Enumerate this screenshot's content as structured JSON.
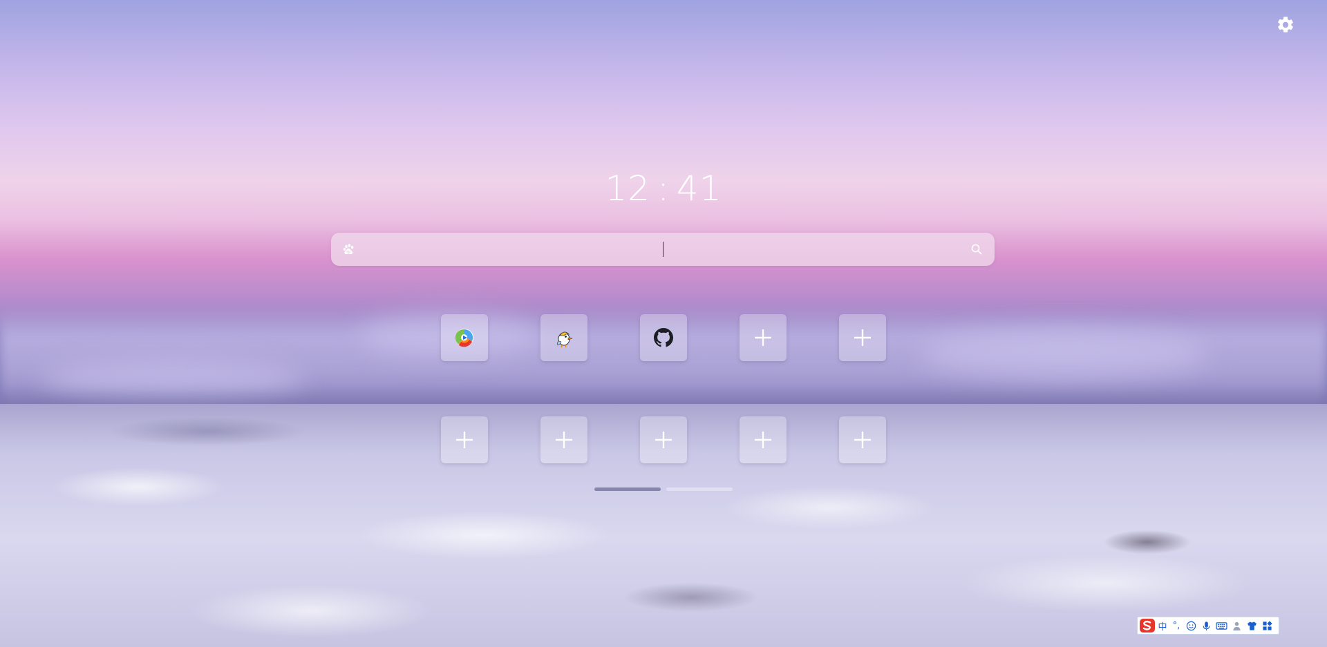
{
  "clock": {
    "hours": "12",
    "separator": ":",
    "minutes": "41"
  },
  "search": {
    "engine_icon": "baidu-paw-icon",
    "placeholder": "",
    "value": "",
    "submit_icon": "search-icon"
  },
  "settings": {
    "icon": "gear-icon"
  },
  "shortcuts": {
    "row1": [
      {
        "icon": "tencent-video-icon"
      },
      {
        "icon": "bird-mascot-icon"
      },
      {
        "icon": "github-icon"
      },
      {
        "icon": "add-icon"
      },
      {
        "icon": "add-icon"
      }
    ],
    "row2": [
      {
        "icon": "add-icon"
      },
      {
        "icon": "add-icon"
      },
      {
        "icon": "add-icon"
      },
      {
        "icon": "add-icon"
      },
      {
        "icon": "add-icon"
      }
    ]
  },
  "pager": {
    "pages": 2,
    "active_page": 1
  },
  "ime_toolbar": {
    "logo": "sogou-logo-icon",
    "mode_label": "中",
    "punct_label": "°,",
    "icons": [
      "emoji-icon",
      "microphone-icon",
      "keyboard-icon",
      "person-icon",
      "tshirt-icon",
      "grid-icon"
    ]
  },
  "colors": {
    "accent_ime": "#1a5fd0",
    "sogou_red": "#e8362b",
    "tile_bg": "rgba(255,255,255,0.28)",
    "search_bg": "rgba(240,216,236,0.78)"
  }
}
